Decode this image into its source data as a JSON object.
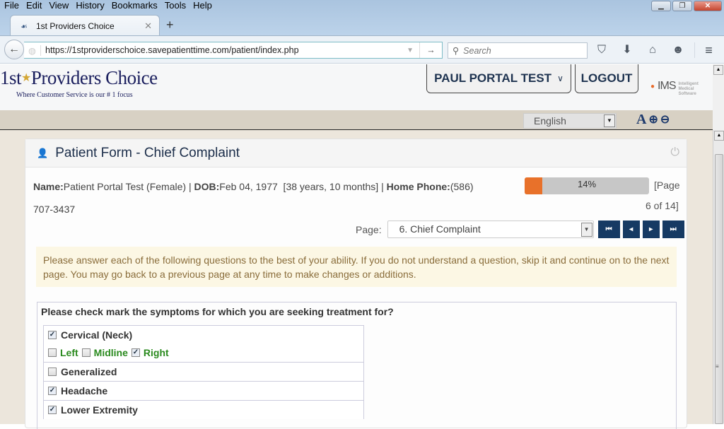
{
  "browser": {
    "menu": [
      "File",
      "Edit",
      "View",
      "History",
      "Bookmarks",
      "Tools",
      "Help"
    ],
    "window_buttons": {
      "minimize": "minimize-icon",
      "restore": "restore-icon",
      "close": "close-icon"
    },
    "tab_title": "1st Providers Choice",
    "url": "https://1stproviderschoice.savepatienttime.com/patient/index.php",
    "search_placeholder": "Search",
    "toolbar_icons": [
      "pocket-icon",
      "download-icon",
      "home-icon",
      "chat-icon"
    ]
  },
  "header": {
    "logo_main_pre": "1st",
    "logo_main_post": "Providers Choice",
    "logo_tagline": "Where Customer Service is our # 1 focus",
    "user_button": "PAUL PORTAL TEST",
    "logout_button": "LOGOUT",
    "ims_text": "IMS",
    "ims_sub": "Intelligent Medical Software",
    "language": "English"
  },
  "card": {
    "title": "Patient Form - Chief Complaint",
    "name_label": "Name:",
    "name_value": "Patient Portal Test (Female) | ",
    "dob_label": "DOB:",
    "dob_value": "Feb 04, 1977  [38 years, 10 months] | ",
    "phone_label": "Home Phone:",
    "phone_value": "(586)",
    "phone_value_2": "707-3437",
    "progress_percent": 14,
    "progress_text": "14%",
    "page_info_1": "[Page",
    "page_info_2": "6 of 14]",
    "page_label": "Page:",
    "page_selected": "6. Chief Complaint",
    "instructions": "Please answer each of the following questions to the best of your ability. If you do not understand a question, skip it and continue on to the next page. You may go back to a previous page at any time to make changes or additions.",
    "question": "Please check mark the symptoms for which you are seeking treatment for?",
    "options": [
      {
        "label": "Cervical (Neck)",
        "checked": true,
        "sub": [
          {
            "label": "Left",
            "checked": false
          },
          {
            "label": "Midline",
            "checked": false
          },
          {
            "label": "Right",
            "checked": true
          }
        ]
      },
      {
        "label": "Generalized",
        "checked": false
      },
      {
        "label": "Headache",
        "checked": true
      },
      {
        "label": "Lower Extremity",
        "checked": true
      }
    ]
  },
  "colors": {
    "accent": "#163a63",
    "progress": "#e8712a",
    "alert_bg": "#fcf7e4",
    "sub_label": "#2a8a1e"
  }
}
